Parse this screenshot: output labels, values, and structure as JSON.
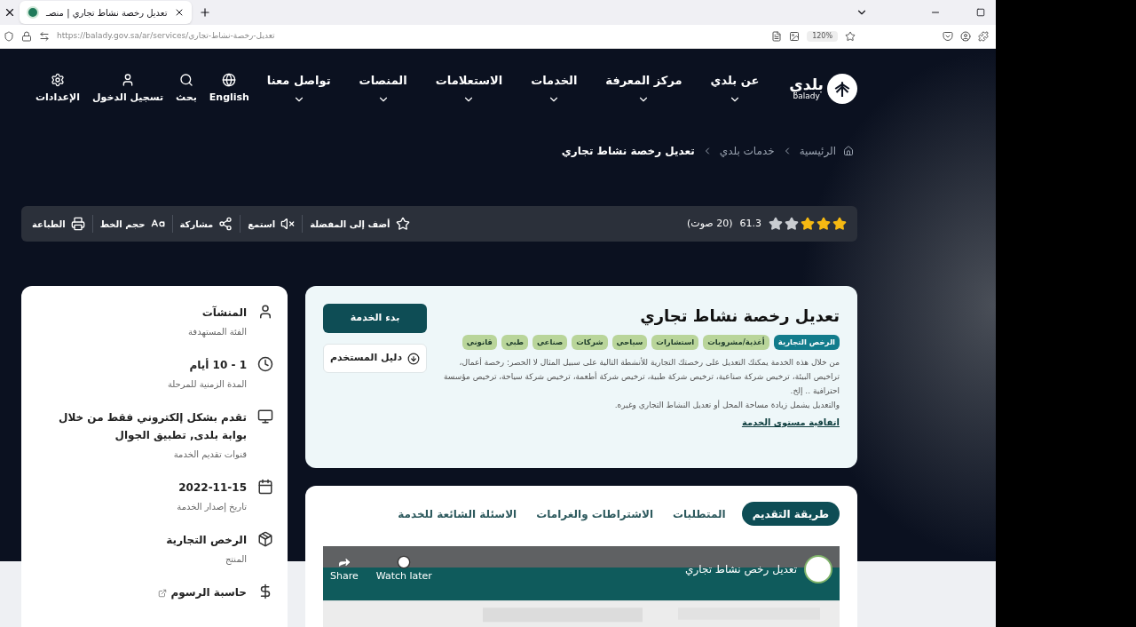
{
  "browser": {
    "tab_title": "تعديل رخصة نشاط تجاري | منصـ",
    "url": "https://balady.gov.sa/ar/services/تعديل-رخصة-نشاط-تجاري",
    "zoom": "120%"
  },
  "logo": {
    "name_ar": "بلدي",
    "name_en": "balady"
  },
  "nav": [
    {
      "label": "عن بلدي"
    },
    {
      "label": "مركز المعرفة"
    },
    {
      "label": "الخدمات"
    },
    {
      "label": "الاستعلامات"
    },
    {
      "label": "المنصات"
    },
    {
      "label": "تواصل معنا"
    }
  ],
  "header_actions": [
    {
      "label": "English"
    },
    {
      "label": "بحث"
    },
    {
      "label": "تسجيل الدخول"
    },
    {
      "label": "الإعدادات"
    }
  ],
  "breadcrumb": [
    "الرئيسية",
    "خدمات بلدي",
    "تعديل رخصة نشاط تجاري"
  ],
  "rating": {
    "stars": 3,
    "score": "61.3",
    "votes": "(20 صوت)"
  },
  "toolbar": [
    {
      "label": "أضف إلى المفضلة"
    },
    {
      "label": "استمع"
    },
    {
      "label": "مشاركة"
    },
    {
      "label": "حجم الخط"
    },
    {
      "label": "الطباعة"
    }
  ],
  "service": {
    "title": "تعديل رخصة نشاط تجاري",
    "tags": [
      {
        "label": "الرخص التجارية",
        "selected": true
      },
      {
        "label": "أغذية/مشروبات",
        "selected": false
      },
      {
        "label": "استشارات",
        "selected": false
      },
      {
        "label": "سياحي",
        "selected": false
      },
      {
        "label": "شركات",
        "selected": false
      },
      {
        "label": "صناعي",
        "selected": false
      },
      {
        "label": "طبي",
        "selected": false
      },
      {
        "label": "قانوني",
        "selected": false
      }
    ],
    "description": [
      "من خلال هذه الخدمة يمكنك التعديل على رخصتك التجارية للأنشطة التالية على سبيل المثال لا الحصر: رخصة أعمال، تراخيص البيئة، ترخيص شركة صناعية، ترخيص شركة طبية، ترخيص شركة أطعمة، ترخيص شركة سياحة، ترخيص مؤسسة احترافية .. إلخ.",
      "والتعديل يشمل زيادة مساحة المحل أو تعديل النشاط التجاري وغيره."
    ],
    "sla_link": "اتفاقية مستوى الخدمة",
    "start_button": "بدء الخدمة",
    "guide_button": "دليل المستخدم"
  },
  "tabs": [
    {
      "label": "طريقة التقديم",
      "selected": true
    },
    {
      "label": "المتطلبات",
      "selected": false
    },
    {
      "label": "الاشتراطات والغرامات",
      "selected": false
    },
    {
      "label": "الاسئلة الشائعة للخدمة",
      "selected": false
    }
  ],
  "video": {
    "title": "تعديل رخص نشاط تجاري",
    "watch_later": "Watch later",
    "share": "Share"
  },
  "details": [
    {
      "value": "المنشآت",
      "label": "الفئة المستهدفة"
    },
    {
      "value": "1 - 10 أيام",
      "label": "المدة الزمنية للمرحلة"
    },
    {
      "value": "تقدم بشكل إلكتروني فقط من خلال بوابة بلدى, تطبيق الجوال",
      "label": "قنوات تقديم الخدمة"
    },
    {
      "value": "2022-11-15",
      "label": "تاريخ إصدار الخدمة"
    },
    {
      "value": "الرخص التجارية",
      "label": "المنتج"
    },
    {
      "value": "حاسبة الرسوم"
    }
  ]
}
